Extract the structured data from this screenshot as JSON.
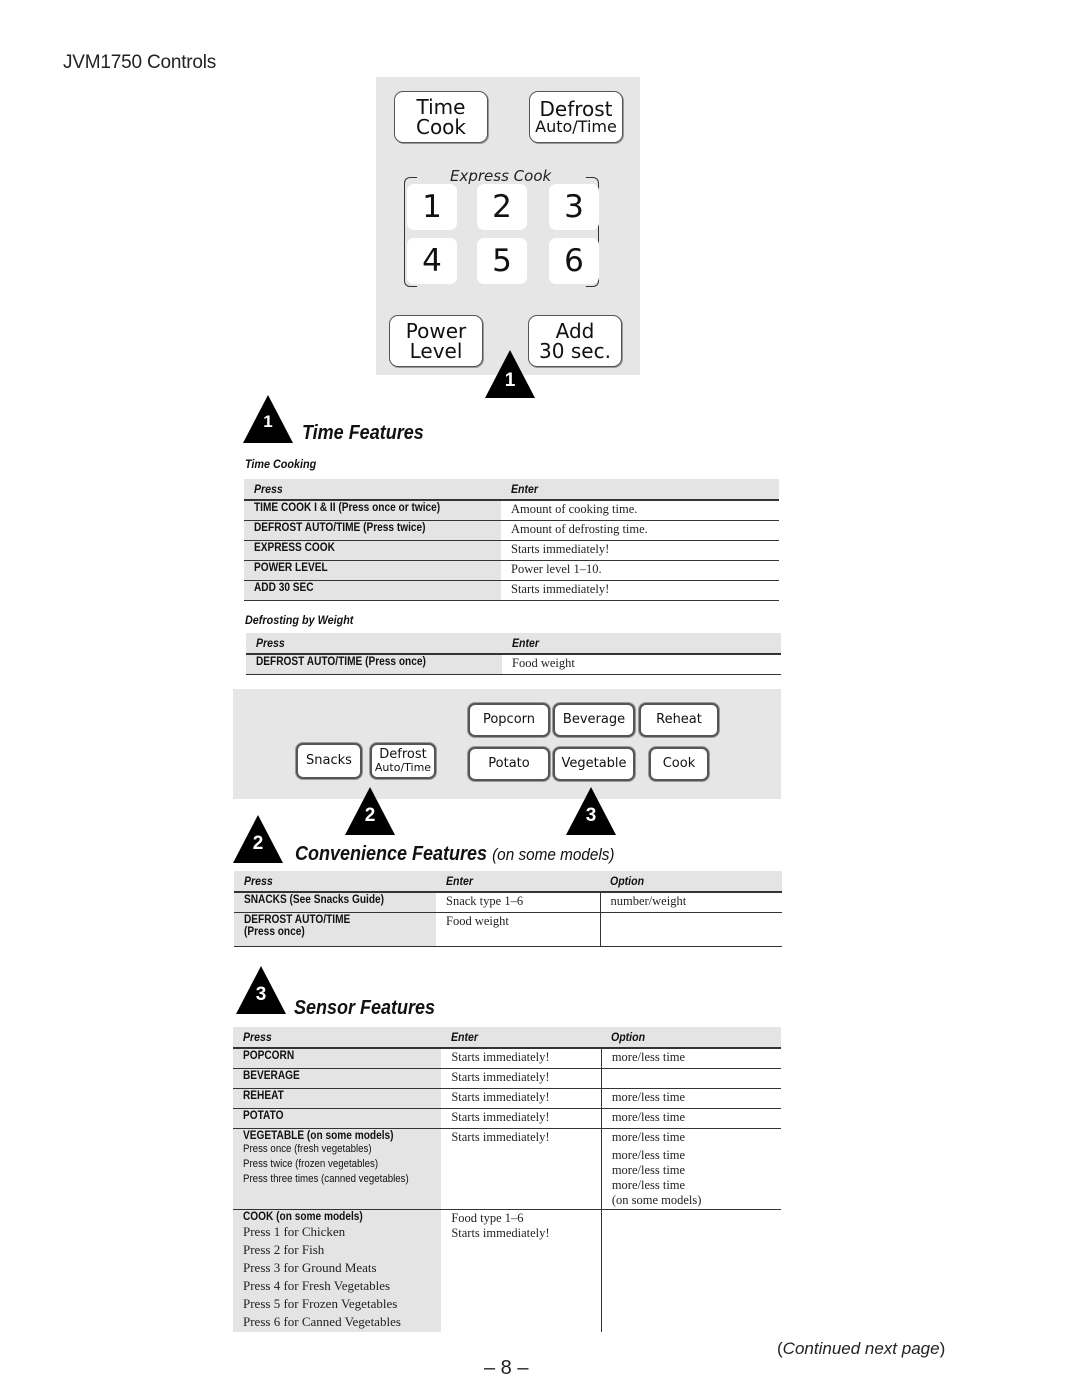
{
  "page": {
    "title": "JVM1750 Controls",
    "page_number": "– 8 –",
    "continued": "Continued next page"
  },
  "top_panel": {
    "time_cook": [
      "Time",
      "Cook"
    ],
    "defrost": [
      "Defrost",
      "Auto/Time"
    ],
    "express_label": "Express Cook",
    "numbers": [
      "1",
      "2",
      "3",
      "4",
      "5",
      "6"
    ],
    "power_level": [
      "Power",
      "Level"
    ],
    "add_30": [
      "Add",
      "30 sec."
    ],
    "marker": "1"
  },
  "time_features": {
    "marker": "1",
    "title": "Time Features",
    "time_cooking": {
      "subhead": "Time Cooking",
      "headers": [
        "Press",
        "Enter"
      ],
      "rows": [
        {
          "press": "TIME COOK I & II (Press once or twice)",
          "enter": "Amount of cooking time."
        },
        {
          "press": "DEFROST AUTO/TIME (Press twice)",
          "enter": "Amount of defrosting time."
        },
        {
          "press": "EXPRESS COOK",
          "enter": "Starts immediately!"
        },
        {
          "press": "POWER LEVEL",
          "enter": "Power level 1–10."
        },
        {
          "press": "ADD 30 SEC",
          "enter": "Starts immediately!"
        }
      ]
    },
    "defrosting_by_weight": {
      "subhead": "Defrosting by Weight",
      "headers": [
        "Press",
        "Enter"
      ],
      "rows": [
        {
          "press": "DEFROST AUTO/TIME (Press once)",
          "enter": "Food weight"
        }
      ]
    }
  },
  "mid_panel": {
    "snacks": "Snacks",
    "defrost": [
      "Defrost",
      "Auto/Time"
    ],
    "popcorn": "Popcorn",
    "beverage": "Beverage",
    "reheat": "Reheat",
    "potato": "Potato",
    "vegetable": "Vegetable",
    "cook": "Cook",
    "marker_2": "2",
    "marker_3": "3"
  },
  "convenience_features": {
    "marker": "2",
    "title": "Convenience Features",
    "subtitle": "(on some models)",
    "headers": [
      "Press",
      "Enter",
      "Option"
    ],
    "rows": [
      {
        "press": "SNACKS (See Snacks Guide)",
        "enter": "Snack type 1–6",
        "option": "number/weight"
      },
      {
        "press": "DEFROST AUTO/TIME",
        "press_2": "(Press once)",
        "enter": "Food weight",
        "option": ""
      }
    ]
  },
  "sensor_features": {
    "marker": "3",
    "title": "Sensor Features",
    "headers": [
      "Press",
      "Enter",
      "Option"
    ],
    "rows": [
      {
        "press": "POPCORN",
        "enter": "Starts immediately!",
        "option": "more/less time"
      },
      {
        "press": "BEVERAGE",
        "enter": "Starts immediately!",
        "option": ""
      },
      {
        "press": "REHEAT",
        "enter": "Starts immediately!",
        "option": "more/less time"
      },
      {
        "press": "POTATO",
        "enter": "Starts immediately!",
        "option": "more/less time"
      }
    ],
    "vegetable": {
      "press": "VEGETABLE (on some models)",
      "sublines": [
        "Press once (fresh vegetables)",
        "Press twice (frozen vegetables)",
        "Press three times (canned vegetables)"
      ],
      "enter": "Starts immediately!",
      "options": [
        "more/less time",
        "more/less time",
        "more/less time",
        "more/less time",
        "(on some models)"
      ]
    },
    "cook": {
      "press": "COOK (on some models)",
      "sublines": [
        "Press 1 for Chicken",
        "Press 2 for Fish",
        "Press 3 for Ground Meats",
        "Press 4 for Fresh Vegetables",
        "Press 5 for Frozen Vegetables",
        "Press 6 for Canned Vegetables"
      ],
      "enter": [
        "Food type 1–6",
        "Starts immediately!"
      ],
      "option": ""
    }
  }
}
